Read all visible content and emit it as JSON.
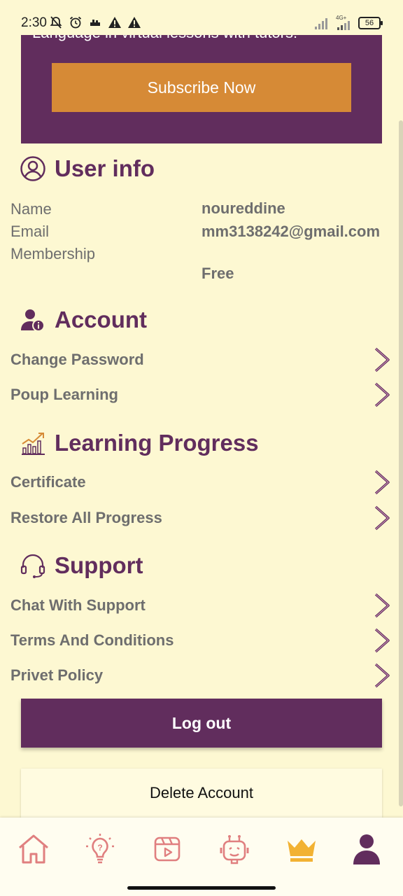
{
  "status_bar": {
    "time": "2:30",
    "network_label": "4G+",
    "battery": "56",
    "icons": [
      "bell-muted-icon",
      "alarm-icon",
      "app-notification-icon",
      "warning-icon",
      "warning-icon",
      "signal-icon",
      "signal-icon",
      "battery-icon"
    ]
  },
  "promo": {
    "text": "Language in virtual lessons with tutors!",
    "subscribe_label": "Subscribe Now"
  },
  "user_info": {
    "title": "User info",
    "labels": {
      "name": "Name",
      "email": "Email",
      "membership": "Membership"
    },
    "values": {
      "name": "noureddine",
      "email": "mm3138242@gmail.com",
      "membership": "Free"
    }
  },
  "account": {
    "title": "Account",
    "items": [
      {
        "label": "Change Password"
      },
      {
        "label": "Poup Learning"
      }
    ]
  },
  "learning_progress": {
    "title": "Learning Progress",
    "items": [
      {
        "label": "Certificate"
      },
      {
        "label": "Restore All Progress"
      }
    ]
  },
  "support": {
    "title": "Support",
    "items": [
      {
        "label": "Chat With Support"
      },
      {
        "label": "Terms And Conditions"
      },
      {
        "label": "Privet Policy"
      }
    ]
  },
  "actions": {
    "logout_label": "Log out",
    "delete_label": "Delete Account"
  },
  "bottom_nav": {
    "items": [
      "home-icon",
      "lightbulb-icon",
      "video-icon",
      "robot-icon",
      "crown-icon",
      "profile-icon"
    ],
    "active": "profile-icon"
  },
  "colors": {
    "background": "#fdf8d2",
    "primary": "#612d5d",
    "accent": "#d68a36",
    "nav_icon": "#e07f7f",
    "crown": "#f2b233"
  }
}
